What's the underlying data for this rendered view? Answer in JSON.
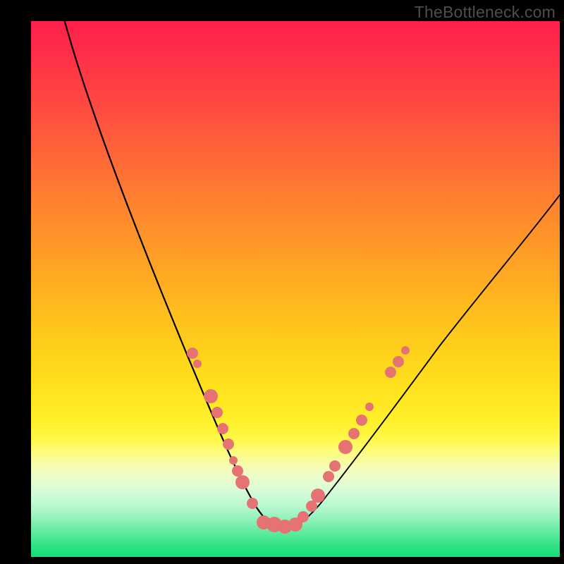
{
  "watermark": "TheBottleneck.com",
  "colors": {
    "bead": "#e57373",
    "curve": "#000000",
    "frame": "#000000"
  },
  "chart_data": {
    "type": "line",
    "title": "",
    "xlabel": "",
    "ylabel": "",
    "xlim": [
      0,
      100
    ],
    "ylim": [
      0,
      100
    ],
    "background_gradient": {
      "direction": "top-to-bottom",
      "stops": [
        {
          "pos": 0,
          "color": "#ff1f4b"
        },
        {
          "pos": 50,
          "color": "#ffbd1e"
        },
        {
          "pos": 78,
          "color": "#fff848"
        },
        {
          "pos": 100,
          "color": "#12de76"
        }
      ]
    },
    "series": [
      {
        "name": "left-curve",
        "x": [
          6,
          10,
          14,
          18,
          22,
          26,
          30,
          33,
          36,
          39,
          41,
          43,
          45,
          47
        ],
        "y": [
          100,
          86,
          72,
          59,
          47,
          37,
          28,
          21,
          15,
          10,
          6,
          3,
          1,
          0
        ]
      },
      {
        "name": "right-curve",
        "x": [
          47,
          49,
          51,
          54,
          58,
          63,
          70,
          78,
          88,
          100
        ],
        "y": [
          0,
          1,
          3,
          8,
          15,
          24,
          35,
          47,
          58,
          70
        ]
      }
    ],
    "beads": [
      {
        "series": "left-curve",
        "x": 30.5,
        "y_pct_from_top": 62,
        "size": "med"
      },
      {
        "series": "left-curve",
        "x": 31.5,
        "y_pct_from_top": 64,
        "size": "small"
      },
      {
        "series": "left-curve",
        "x": 34.0,
        "y_pct_from_top": 70,
        "size": "large"
      },
      {
        "series": "left-curve",
        "x": 35.2,
        "y_pct_from_top": 73,
        "size": "med"
      },
      {
        "series": "left-curve",
        "x": 36.2,
        "y_pct_from_top": 76,
        "size": "med"
      },
      {
        "series": "left-curve",
        "x": 37.3,
        "y_pct_from_top": 79,
        "size": "med"
      },
      {
        "series": "left-curve",
        "x": 38.3,
        "y_pct_from_top": 82,
        "size": "small"
      },
      {
        "series": "left-curve",
        "x": 39.1,
        "y_pct_from_top": 84,
        "size": "med"
      },
      {
        "series": "left-curve",
        "x": 40.0,
        "y_pct_from_top": 86,
        "size": "large"
      },
      {
        "series": "left-curve",
        "x": 41.8,
        "y_pct_from_top": 90,
        "size": "med"
      },
      {
        "series": "bottom",
        "x": 44.0,
        "y_pct_from_top": 93.5,
        "size": "large"
      },
      {
        "series": "bottom",
        "x": 46.0,
        "y_pct_from_top": 94.0,
        "size": "xlarge"
      },
      {
        "series": "bottom",
        "x": 48.0,
        "y_pct_from_top": 94.3,
        "size": "large"
      },
      {
        "series": "bottom",
        "x": 50.0,
        "y_pct_from_top": 94.0,
        "size": "large"
      },
      {
        "series": "right-curve",
        "x": 51.5,
        "y_pct_from_top": 92.5,
        "size": "med"
      },
      {
        "series": "right-curve",
        "x": 53.0,
        "y_pct_from_top": 90.5,
        "size": "med"
      },
      {
        "series": "right-curve",
        "x": 54.2,
        "y_pct_from_top": 88.5,
        "size": "large"
      },
      {
        "series": "right-curve",
        "x": 56.3,
        "y_pct_from_top": 85,
        "size": "med"
      },
      {
        "series": "right-curve",
        "x": 57.5,
        "y_pct_from_top": 83,
        "size": "med"
      },
      {
        "series": "right-curve",
        "x": 59.5,
        "y_pct_from_top": 79.5,
        "size": "large"
      },
      {
        "series": "right-curve",
        "x": 61.0,
        "y_pct_from_top": 77,
        "size": "med"
      },
      {
        "series": "right-curve",
        "x": 62.5,
        "y_pct_from_top": 74.5,
        "size": "med"
      },
      {
        "series": "right-curve",
        "x": 64.0,
        "y_pct_from_top": 72,
        "size": "small"
      },
      {
        "series": "right-curve",
        "x": 68.0,
        "y_pct_from_top": 65.5,
        "size": "med"
      },
      {
        "series": "right-curve",
        "x": 69.5,
        "y_pct_from_top": 63.5,
        "size": "med"
      },
      {
        "series": "right-curve",
        "x": 70.8,
        "y_pct_from_top": 61.5,
        "size": "small"
      }
    ]
  }
}
